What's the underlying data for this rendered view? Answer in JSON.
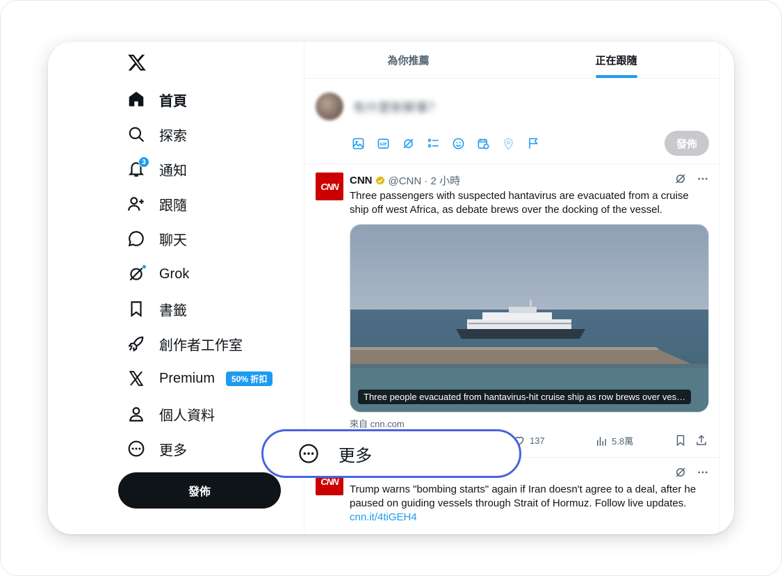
{
  "sidebar": {
    "items": [
      {
        "label": "首頁"
      },
      {
        "label": "探索"
      },
      {
        "label": "通知",
        "badge": "3"
      },
      {
        "label": "跟隨"
      },
      {
        "label": "聊天"
      },
      {
        "label": "Grok"
      },
      {
        "label": "書籤"
      },
      {
        "label": "創作者工作室"
      },
      {
        "label": "Premium",
        "promo": "50% 折扣"
      },
      {
        "label": "個人資料"
      },
      {
        "label": "更多"
      }
    ],
    "post_button": "發佈"
  },
  "tabs": [
    {
      "label": "為你推薦"
    },
    {
      "label": "正在跟隨"
    }
  ],
  "composer": {
    "placeholder": "有什麼新鮮事？",
    "post_button": "發佈"
  },
  "tweets": [
    {
      "avatar_text": "CNN",
      "name": "CNN",
      "handle": "@CNN · 2 小時",
      "text": "Three passengers with suspected hantavirus are evacuated from a cruise ship off west Africa, as debate brews over the docking of the vessel.",
      "media_caption": "Three people evacuated from hantavirus-hit cruise ship as row brews over ves…",
      "source": "來自 cnn.com",
      "likes": "137",
      "views": "5.8萬"
    },
    {
      "avatar_text": "CNN",
      "text": "Trump warns \"bombing starts\" again if Iran doesn't agree to a deal, after he paused on guiding vessels through Strait of Hormuz. Follow live updates.",
      "link": "cnn.it/4tiGEH4"
    }
  ],
  "highlight": {
    "label": "更多"
  },
  "colors": {
    "accent": "#1d9bf0",
    "highlight_border": "#4a63e0",
    "cnn_red": "#cc0000"
  }
}
